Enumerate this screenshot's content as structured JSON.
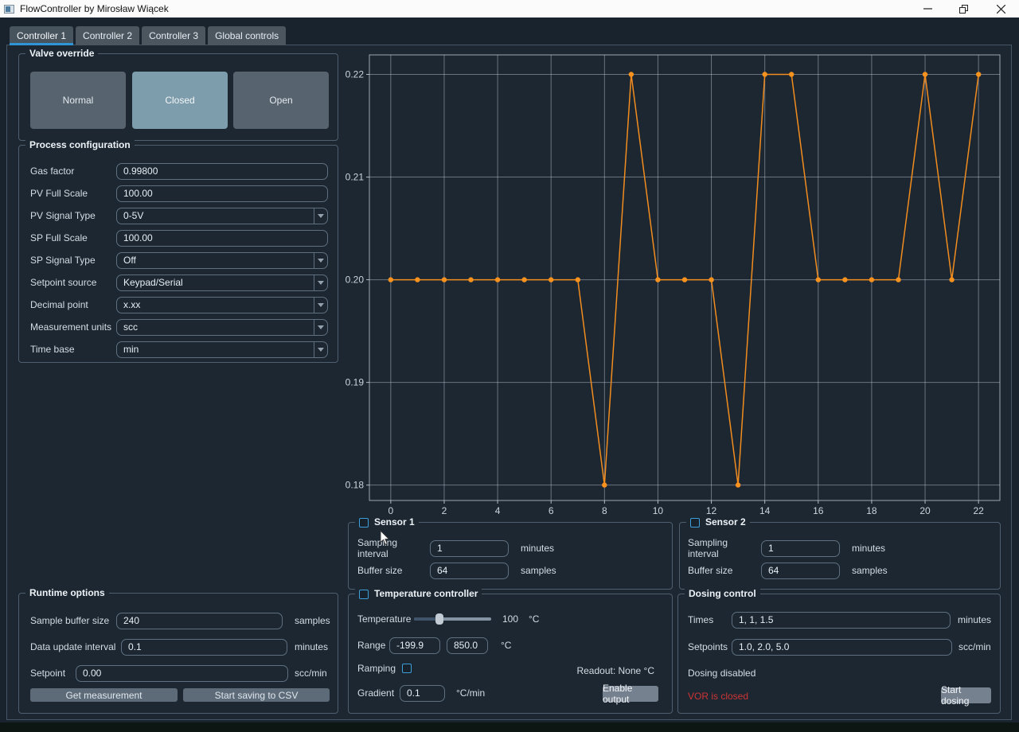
{
  "window": {
    "title": "FlowController by Mirosław Wiącek"
  },
  "colors": {
    "accent": "#33a3e0",
    "series": "#f28c1e",
    "error": "#cf3434",
    "valve_active": "#7d9cac"
  },
  "tabs": [
    {
      "label": "Controller 1",
      "selected": true
    },
    {
      "label": "Controller 2",
      "selected": false
    },
    {
      "label": "Controller 3",
      "selected": false
    },
    {
      "label": "Global controls",
      "selected": false
    }
  ],
  "valve_override": {
    "title": "Valve override",
    "normal": "Normal",
    "closed": "Closed",
    "open": "Open",
    "active": "Closed"
  },
  "process_configuration": {
    "title": "Process configuration",
    "rows": [
      {
        "label": "Gas factor",
        "value": "0.99800",
        "kind": "input"
      },
      {
        "label": "PV Full Scale",
        "value": "100.00",
        "kind": "input"
      },
      {
        "label": "PV Signal Type",
        "value": "0-5V",
        "kind": "combo"
      },
      {
        "label": "SP Full Scale",
        "value": "100.00",
        "kind": "input"
      },
      {
        "label": "SP Signal Type",
        "value": "Off",
        "kind": "combo"
      },
      {
        "label": "Setpoint source",
        "value": "Keypad/Serial",
        "kind": "combo"
      },
      {
        "label": "Decimal point",
        "value": "x.xx",
        "kind": "combo"
      },
      {
        "label": "Measurement units",
        "value": "scc",
        "kind": "combo"
      },
      {
        "label": "Time base",
        "value": "min",
        "kind": "combo"
      }
    ]
  },
  "runtime_options": {
    "title": "Runtime options",
    "rows": [
      {
        "label": "Sample buffer size",
        "value": "240",
        "unit": "samples"
      },
      {
        "label": "Data update interval",
        "value": "0.1",
        "unit": "minutes"
      },
      {
        "label": "Setpoint",
        "value": "0.00",
        "unit": "scc/min"
      }
    ],
    "get_measurement": "Get measurement",
    "start_saving": "Start saving to CSV"
  },
  "sensor1": {
    "title": "Sensor 1",
    "sampling_label": "Sampling interval",
    "sampling_value": "1",
    "sampling_unit": "minutes",
    "buffer_label": "Buffer size",
    "buffer_value": "64",
    "buffer_unit": "samples"
  },
  "sensor2": {
    "title": "Sensor 2",
    "sampling_label": "Sampling interval",
    "sampling_value": "1",
    "sampling_unit": "minutes",
    "buffer_label": "Buffer size",
    "buffer_value": "64",
    "buffer_unit": "samples"
  },
  "temperature_controller": {
    "title": "Temperature controller",
    "temperature_label": "Temperature",
    "temperature_value": "100",
    "temperature_unit": "°C",
    "range_label": "Range",
    "range_min": "-199.9",
    "range_max": "850.0",
    "range_unit": "°C",
    "ramping_label": "Ramping",
    "readout": "Readout: None °C",
    "gradient_label": "Gradient",
    "gradient_value": "0.1",
    "gradient_unit": "°C/min",
    "enable_output": "Enable output"
  },
  "dosing_control": {
    "title": "Dosing control",
    "times_label": "Times",
    "times_value": "1, 1, 1.5",
    "times_unit": "minutes",
    "setpoints_label": "Setpoints",
    "setpoints_value": "1.0, 2.0, 5.0",
    "setpoints_unit": "scc/min",
    "status": "Dosing disabled",
    "vor_status": "VOR is closed",
    "start_dosing": "Start dosing"
  },
  "chart_data": {
    "type": "line",
    "title": "",
    "xlabel": "",
    "ylabel": "",
    "x": [
      0,
      1,
      2,
      3,
      4,
      5,
      6,
      7,
      8,
      9,
      10,
      11,
      12,
      13,
      14,
      15,
      16,
      17,
      18,
      19,
      20,
      21,
      22
    ],
    "values": [
      0.2,
      0.2,
      0.2,
      0.2,
      0.2,
      0.2,
      0.2,
      0.2,
      0.18,
      0.22,
      0.2,
      0.2,
      0.2,
      0.18,
      0.22,
      0.22,
      0.2,
      0.2,
      0.2,
      0.2,
      0.22,
      0.2,
      0.22
    ],
    "series_color": "#f28c1e",
    "xticks": [
      0,
      2,
      4,
      6,
      8,
      10,
      12,
      14,
      16,
      18,
      20,
      22
    ],
    "yticks": [
      0.18,
      0.19,
      0.2,
      0.21,
      0.22
    ],
    "xlim": [
      -0.8,
      22.8
    ],
    "ylim": [
      0.1785,
      0.2219
    ],
    "grid": true,
    "legend": false
  }
}
